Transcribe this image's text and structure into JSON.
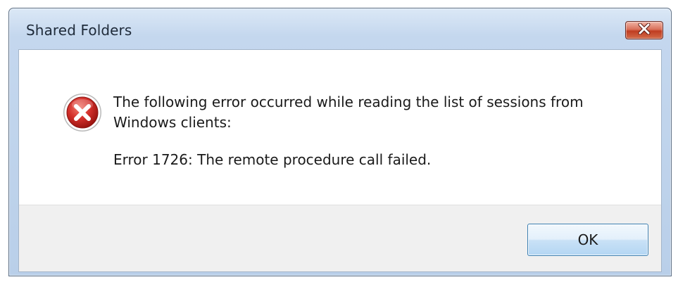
{
  "window": {
    "title": "Shared Folders",
    "close_icon": "close-icon"
  },
  "message": {
    "icon": "error-icon",
    "line1": "The following error occurred while reading the list of sessions from",
    "line2": "Windows clients:",
    "detail": "Error 1726: The remote procedure call failed."
  },
  "buttons": {
    "ok_label": "OK"
  },
  "colors": {
    "error_red": "#cc2a2a",
    "close_button_red": "#c03d22",
    "titlebar_blue": "#c4d7ee"
  }
}
